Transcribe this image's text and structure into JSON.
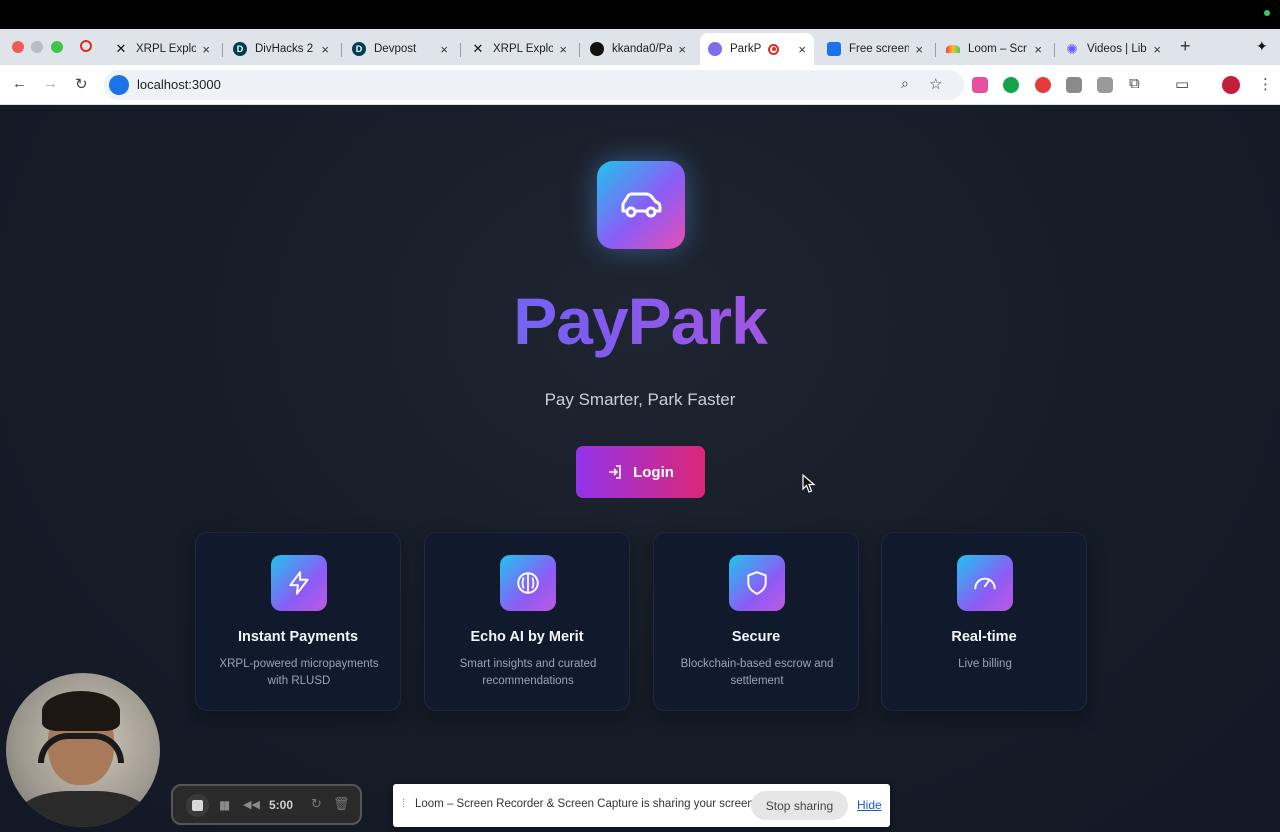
{
  "browser": {
    "tabs": [
      {
        "title": "XRPL Explo",
        "icon": "x-icon"
      },
      {
        "title": "DivHacks 2",
        "icon": "devpost-icon"
      },
      {
        "title": "Devpost",
        "icon": "devpost-icon"
      },
      {
        "title": "XRPL Explo",
        "icon": "x-icon"
      },
      {
        "title": "kkanda0/Pa",
        "icon": "github-icon"
      },
      {
        "title": "ParkPay",
        "icon": "parkpay-icon",
        "active": true,
        "recording": true
      },
      {
        "title": "Free screen",
        "icon": "screen-icon"
      },
      {
        "title": "Loom – Scr",
        "icon": "loom-icon"
      },
      {
        "title": "Videos | Lib",
        "icon": "loom-star-icon"
      }
    ],
    "new_tab_symbol": "+",
    "url": "localhost:3000"
  },
  "hero": {
    "logo_icon": "car-icon",
    "brand": "PayPark",
    "tagline": "Pay Smarter, Park Faster",
    "login_label": "Login"
  },
  "features": [
    {
      "title": "Instant Payments",
      "desc": "XRPL-powered micropayments with RLUSD",
      "icon": "lightning-icon"
    },
    {
      "title": "Echo AI by Merit",
      "desc": "Smart insights and curated recommendations",
      "icon": "brain-icon"
    },
    {
      "title": "Secure",
      "desc": "Blockchain-based escrow and settlement",
      "icon": "shield-icon"
    },
    {
      "title": "Real-time",
      "desc": "Live billing",
      "icon": "gauge-icon"
    }
  ],
  "recorder": {
    "time": "5:00"
  },
  "share_notice": {
    "message": "Loom – Screen Recorder & Screen Capture is sharing your screen.",
    "stop_label": "Stop sharing",
    "hide_label": "Hide"
  },
  "colors": {
    "accent_start": "#9333ea",
    "accent_end": "#db2777",
    "brand_cyan": "#22c3ee",
    "brand_violet": "#8b5cf6",
    "page_bg": "#161c27"
  }
}
